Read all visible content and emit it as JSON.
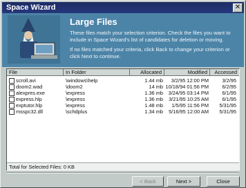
{
  "window": {
    "title": "Space Wizard",
    "close_glyph": "✕"
  },
  "header": {
    "title": "Large Files",
    "line1": "These files match your selection criterion. Check the files you want to include in Space Wizard's list of candidates for deletion or moving.",
    "line2": "If no files matched your criteria, click Back to change your criterion or click Next to continue."
  },
  "table": {
    "columns": [
      "File",
      "In Folder",
      "Allocated",
      "Modified",
      "Accessed"
    ],
    "rows": [
      {
        "file": "scroll.avi",
        "folder": "\\windows\\help",
        "allocated": "1.44 mb",
        "modified": "3/2/95 12:00 PM",
        "accessed": "3/2/95"
      },
      {
        "file": "doom2.wad",
        "folder": "\\doom2",
        "allocated": "14 mb",
        "modified": "10/18/94 01:56 PM",
        "accessed": "6/2/95"
      },
      {
        "file": "alexpres.exe",
        "folder": "\\express",
        "allocated": "1.36 mb",
        "modified": "3/24/95 03:14 PM",
        "accessed": "6/1/95"
      },
      {
        "file": "express.hlp",
        "folder": "\\express",
        "allocated": "1.36 mb",
        "modified": "3/21/95 10:25 AM",
        "accessed": "6/1/95"
      },
      {
        "file": "exptutor.hlp",
        "folder": "\\express",
        "allocated": "1.48 mb",
        "modified": "1/5/95 11:56 PM",
        "accessed": "5/31/95"
      },
      {
        "file": "msspc32.dll",
        "folder": "\\schdplus",
        "allocated": "1.34 mb",
        "modified": "5/16/95 12:00 AM",
        "accessed": "5/31/95"
      }
    ],
    "total": "Total for Selected Files: 0 KB"
  },
  "buttons": {
    "back": "< Back",
    "next": "Next >",
    "close": "Close"
  },
  "icons": {
    "wizard_art": "wizard-with-laptop-icon"
  },
  "colors": {
    "title_bar": "#1c2c64",
    "header_bg": "#4c84a8",
    "face": "#c3cbc8"
  }
}
